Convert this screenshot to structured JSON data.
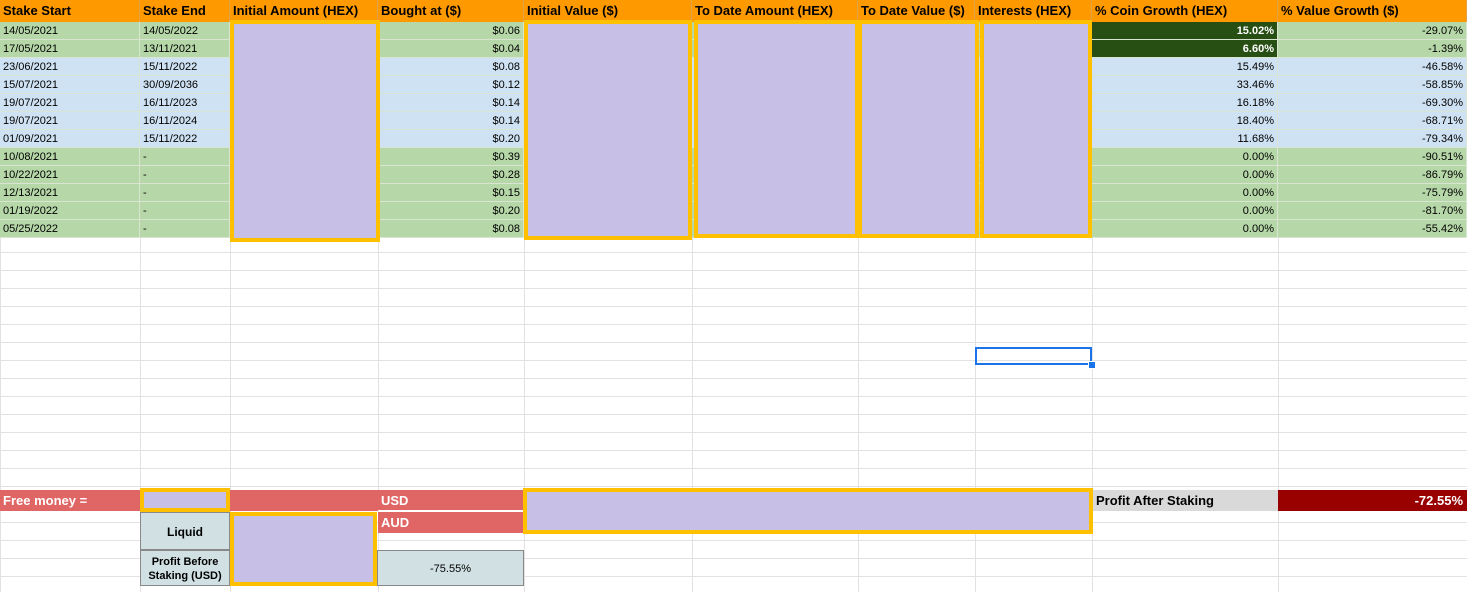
{
  "columns": [
    "Stake Start",
    "Stake End",
    "Initial Amount (HEX)",
    "Bought at ($)",
    "Initial Value ($)",
    "To Date Amount (HEX)",
    "To Date Value ($)",
    "Interests (HEX)",
    "% Coin Growth (HEX)",
    "% Value Growth ($)"
  ],
  "rows": [
    {
      "start": "14/05/2021",
      "end": "14/05/2022",
      "bought": "$0.06",
      "coin_growth": "15.02%",
      "value_growth": "-29.07%",
      "status": "green",
      "highlight": true
    },
    {
      "start": "17/05/2021",
      "end": "13/11/2021",
      "bought": "$0.04",
      "coin_growth": "6.60%",
      "value_growth": "-1.39%",
      "status": "green",
      "highlight": true
    },
    {
      "start": "23/06/2021",
      "end": "15/11/2022",
      "bought": "$0.08",
      "coin_growth": "15.49%",
      "value_growth": "-46.58%",
      "status": "blue",
      "highlight": false
    },
    {
      "start": "15/07/2021",
      "end": "30/09/2036",
      "bought": "$0.12",
      "coin_growth": "33.46%",
      "value_growth": "-58.85%",
      "status": "blue",
      "highlight": false
    },
    {
      "start": "19/07/2021",
      "end": "16/11/2023",
      "bought": "$0.14",
      "coin_growth": "16.18%",
      "value_growth": "-69.30%",
      "status": "blue",
      "highlight": false
    },
    {
      "start": "19/07/2021",
      "end": "16/11/2024",
      "bought": "$0.14",
      "coin_growth": "18.40%",
      "value_growth": "-68.71%",
      "status": "blue",
      "highlight": false
    },
    {
      "start": "01/09/2021",
      "end": "15/11/2022",
      "bought": "$0.20",
      "coin_growth": "11.68%",
      "value_growth": "-79.34%",
      "status": "blue",
      "highlight": false
    },
    {
      "start": "10/08/2021",
      "end": "-",
      "bought": "$0.39",
      "coin_growth": "0.00%",
      "value_growth": "-90.51%",
      "status": "green",
      "highlight": false
    },
    {
      "start": "10/22/2021",
      "end": "-",
      "bought": "$0.28",
      "coin_growth": "0.00%",
      "value_growth": "-86.79%",
      "status": "green",
      "highlight": false
    },
    {
      "start": "12/13/2021",
      "end": "-",
      "bought": "$0.15",
      "coin_growth": "0.00%",
      "value_growth": "-75.79%",
      "status": "green",
      "highlight": false
    },
    {
      "start": "01/19/2022",
      "end": "-",
      "bought": "$0.20",
      "coin_growth": "0.00%",
      "value_growth": "-81.70%",
      "status": "green",
      "highlight": false
    },
    {
      "start": "05/25/2022",
      "end": "-",
      "bought": "$0.08",
      "coin_growth": "0.00%",
      "value_growth": "-55.42%",
      "status": "green",
      "highlight": false
    }
  ],
  "summary": {
    "free_money_label": "Free money =",
    "usd_label": "USD",
    "aud_label": "AUD",
    "liquid_label": "Liquid",
    "profit_before_label": "Profit Before\nStaking (USD)",
    "profit_before_value": "-75.55%",
    "profit_after_label": "Profit After Staking",
    "profit_after_value": "-72.55%"
  },
  "colors": {
    "header": "#ff9900",
    "green_row": "#b6d7a8",
    "blue_row": "#cfe2f3",
    "dark_green": "#274e13",
    "free_money_red": "#e06666",
    "profit_after_red": "#990000",
    "liquid_gray": "#d0e0e3",
    "redaction": "#c7bfe6",
    "redaction_border": "#ffc000",
    "selection": "#1a73e8"
  }
}
